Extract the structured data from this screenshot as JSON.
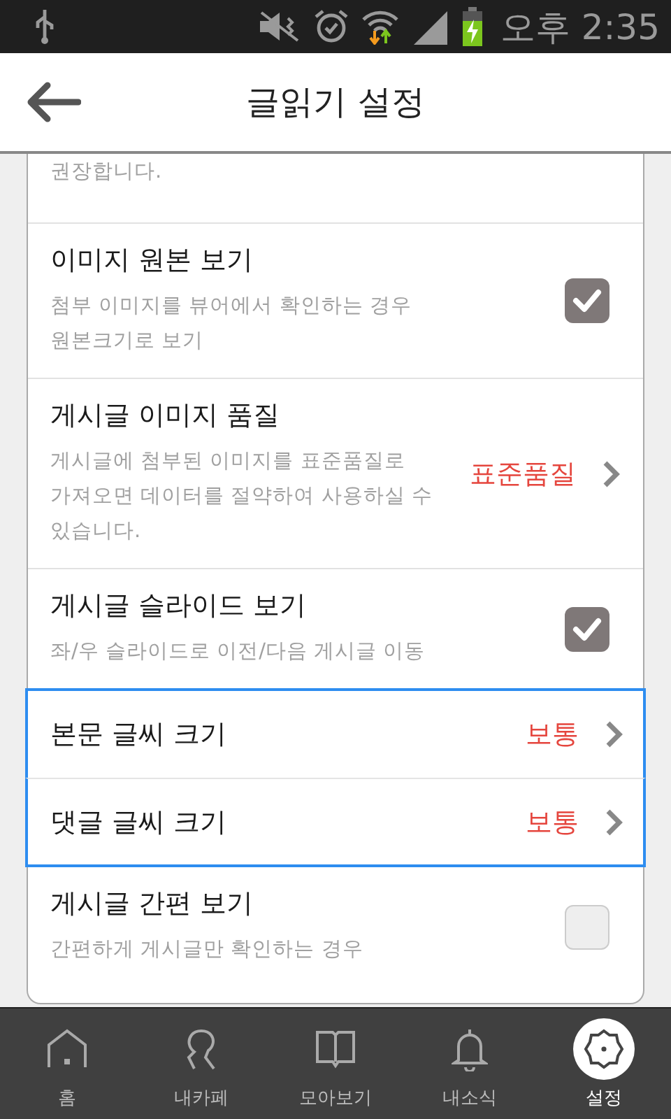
{
  "status_bar": {
    "time": "오후 2:35"
  },
  "header": {
    "title": "글읽기 설정"
  },
  "settings": [
    {
      "kind": "note",
      "description": "권장합니다.",
      "focused": false
    },
    {
      "kind": "checkbox",
      "title": "이미지 원본 보기",
      "description": "첨부 이미지를 뷰어에서 확인하는 경우\n원본크기로 보기",
      "checked": true,
      "focused": false
    },
    {
      "kind": "value",
      "title": "게시글 이미지 품질",
      "description": "게시글에 첨부된 이미지를 표준품질로\n가져오면 데이터를 절약하여 사용하실 수\n있습니다.",
      "value": "표준품질",
      "focused": false
    },
    {
      "kind": "checkbox",
      "title": "게시글 슬라이드 보기",
      "description": "좌/우 슬라이드로 이전/다음 게시글 이동",
      "checked": true,
      "focused": false
    },
    {
      "kind": "value",
      "title": "본문 글씨 크기",
      "value": "보통",
      "focused": true
    },
    {
      "kind": "value",
      "title": "댓글 글씨 크기",
      "value": "보통",
      "focused": true
    },
    {
      "kind": "checkbox",
      "title": "게시글 간편 보기",
      "description": "간편하게 게시글만 확인하는 경우",
      "checked": false,
      "focused": false
    }
  ],
  "nav": [
    {
      "label": "홈",
      "selected": false
    },
    {
      "label": "내카페",
      "selected": false
    },
    {
      "label": "모아보기",
      "selected": false
    },
    {
      "label": "내소식",
      "selected": false
    },
    {
      "label": "설정",
      "selected": true
    }
  ]
}
